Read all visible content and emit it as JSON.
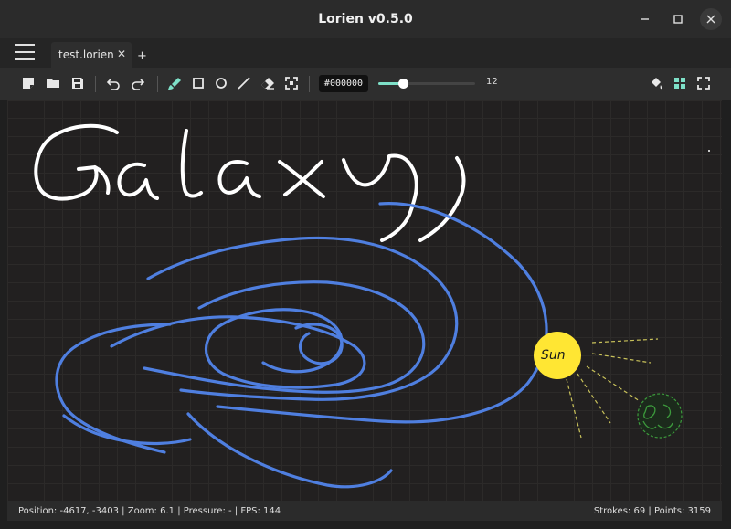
{
  "window": {
    "title": "Lorien v0.5.0",
    "controls": {
      "minimize": "–",
      "maximize": "☐",
      "close": "✕"
    }
  },
  "tabs": {
    "items": [
      {
        "label": "test.lorien",
        "close": "✕"
      }
    ],
    "add_label": "+"
  },
  "toolbar": {
    "file_tools": [
      "new-file-icon",
      "open-folder-icon",
      "save-icon"
    ],
    "history_tools": [
      "undo-icon",
      "redo-icon"
    ],
    "draw_tools": [
      "brush-icon",
      "rectangle-icon",
      "circle-icon",
      "line-icon",
      "eraser-icon",
      "selection-icon"
    ],
    "active_tool": "brush-icon",
    "color_value": "#000000",
    "brush_size": "12",
    "brush_size_fraction": 0.25,
    "right_tools": [
      "fill-icon",
      "grid-icon",
      "fullscreen-icon"
    ]
  },
  "canvas": {
    "handwriting_text": "Galaxy",
    "sun_label": "Sun",
    "colors": {
      "background": "#222020",
      "grid": "#2c2a29",
      "white_ink": "#ffffff",
      "blue_ink": "#4f7fe0",
      "sun": "#ffe633",
      "rays": "#c9c25a",
      "earth": "#3c9a3c"
    }
  },
  "status": {
    "position": "Position: -4617, -3403",
    "zoom": "Zoom: 6.1",
    "pressure": "Pressure: -",
    "fps": "FPS: 144",
    "strokes": "Strokes: 69",
    "points": "Points: 3159"
  },
  "accent_color": "#7ee0c8"
}
